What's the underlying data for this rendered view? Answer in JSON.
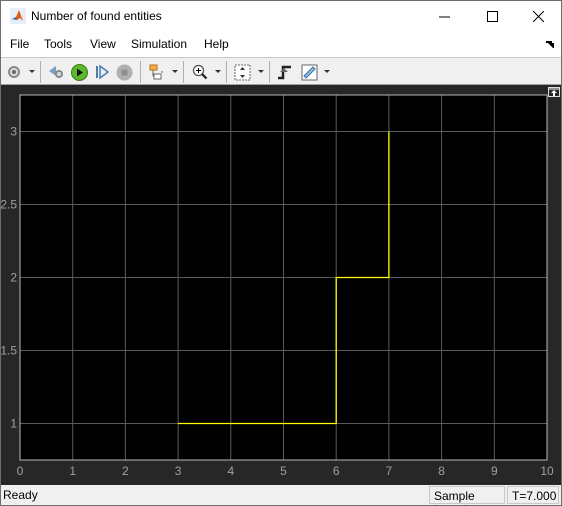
{
  "window": {
    "title": "Number of found entities",
    "controls": {
      "minimize": "minimize",
      "maximize": "maximize",
      "close": "close"
    }
  },
  "menu": {
    "items": [
      {
        "label": "File"
      },
      {
        "label": "Tools"
      },
      {
        "label": "View"
      },
      {
        "label": "Simulation"
      },
      {
        "label": "Help"
      }
    ]
  },
  "toolbar": {
    "buttons": [
      {
        "icon": "settings-gear-icon",
        "has_dropdown": true
      },
      {
        "icon": "step-back-icon"
      },
      {
        "icon": "run-icon"
      },
      {
        "icon": "step-forward-icon"
      },
      {
        "icon": "stop-icon",
        "enabled": false
      },
      {
        "icon": "highlight-block-icon",
        "has_dropdown": true
      },
      {
        "icon": "zoom-in-icon",
        "has_dropdown": true
      },
      {
        "icon": "scale-y-axis-icon",
        "has_dropdown": true
      },
      {
        "icon": "triggers-icon"
      },
      {
        "icon": "cursor-measurements-icon",
        "has_dropdown": true
      }
    ]
  },
  "status": {
    "left": "Ready",
    "mode": "Sample based",
    "time": "T=7.000"
  },
  "colors": {
    "signal": "#ffff00",
    "plot_bg": "#000000",
    "scope_bg": "#272727",
    "grid": "#5a5a5a",
    "tick_label": "#a0a0a0"
  },
  "chart_data": {
    "type": "line",
    "title": "",
    "xlabel": "",
    "ylabel": "",
    "xlim": [
      0,
      10
    ],
    "ylim": [
      0.75,
      3.25
    ],
    "x_ticks": [
      0,
      1,
      2,
      3,
      4,
      5,
      6,
      7,
      8,
      9,
      10
    ],
    "y_ticks": [
      1,
      1.5,
      2,
      2.5,
      3
    ],
    "x_tick_labels": [
      "0",
      "1",
      "2",
      "3",
      "4",
      "5",
      "6",
      "7",
      "8",
      "9",
      "10"
    ],
    "y_tick_labels": [
      "1",
      "1.5",
      "2",
      "2.5",
      "3"
    ],
    "grid": true,
    "legend": "none",
    "series": [
      {
        "name": "Number of found entities",
        "step": true,
        "x": [
          3,
          6,
          6,
          7,
          7
        ],
        "y": [
          1,
          1,
          2,
          2,
          3
        ]
      }
    ]
  }
}
